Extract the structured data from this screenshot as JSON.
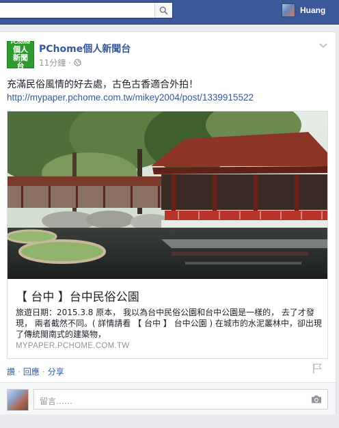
{
  "topbar": {
    "search_placeholder": "",
    "profile_name": "Huang"
  },
  "post": {
    "page_name": "PChome個人新聞台",
    "logo_top": "PChome",
    "logo_bottom": "個人新聞台",
    "time": "11分鐘",
    "separator": "·",
    "text": "充滿民俗風情的好去處，古色古香適合外拍！",
    "link": "http://mypaper.pchome.com.tw/mikey2004/post/1339915522"
  },
  "preview": {
    "title": "【 台中 】台中民俗公園",
    "description": "旅遊日期：2015.3.8 原本， 我以為台中民俗公園和台中公園是一樣的， 去了才發現， 兩者截然不同。( 詳情請看 【 台中 】 台中公園 ) 在城市的水泥叢林中，卻出現了傳統閩南式的建築物，",
    "domain": "MYPAPER.PCHOME.COM.TW"
  },
  "actions": {
    "like": "讚",
    "comment": "回應",
    "share": "分享",
    "dot": "·"
  },
  "comment_box": {
    "placeholder": "留言……"
  },
  "colors": {
    "topbar": "#3b5998",
    "link": "#365899",
    "meta": "#90949c",
    "logo_green": "#2f9a2f"
  }
}
